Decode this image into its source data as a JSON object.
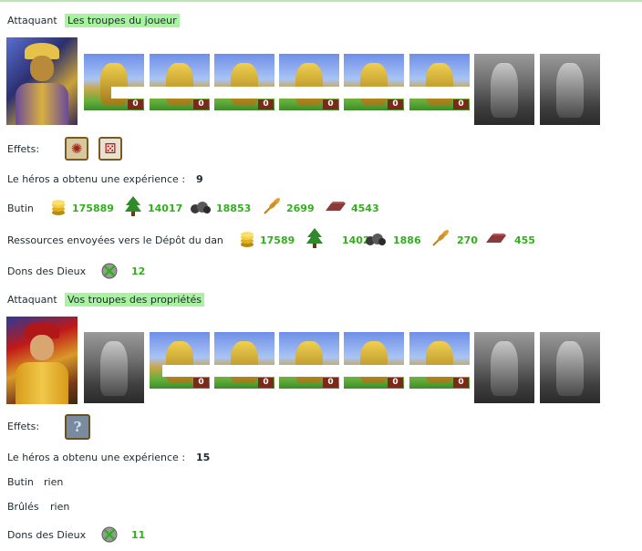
{
  "section1": {
    "attaquant_label": "Attaquant",
    "group_label": "Les troupes du joueur",
    "effets_label": "Effets:",
    "effect_icons": [
      "war-drums-effect-icon",
      "dice-effect-icon"
    ],
    "xp_label": "Le héros a obtenu une expérience :",
    "xp_value": "9",
    "butin_label": "Butin",
    "butin": [
      {
        "icon": "gold-coins-icon",
        "value": "175889"
      },
      {
        "icon": "wood-tree-icon",
        "value": "14017"
      },
      {
        "icon": "ore-stone-icon",
        "value": "18853"
      },
      {
        "icon": "wheat-icon",
        "value": "2699"
      },
      {
        "icon": "iron-ingot-icon",
        "value": "4543"
      }
    ],
    "sent_label": "Ressources envoyées vers le Dépôt du dan",
    "sent": [
      {
        "icon": "gold-coins-icon",
        "value": "17589"
      },
      {
        "icon": "wood-tree-icon",
        "value": "1402"
      },
      {
        "icon": "ore-stone-icon",
        "value": "1886"
      },
      {
        "icon": "wheat-icon",
        "value": "270"
      },
      {
        "icon": "iron-ingot-icon",
        "value": "455"
      }
    ],
    "dons_label": "Dons des Dieux",
    "dons_value": "12",
    "unit_counts": [
      "0",
      "0",
      "0",
      "0",
      "0",
      "0"
    ]
  },
  "section2": {
    "attaquant_label": "Attaquant",
    "group_label": "Vos troupes des propriétés",
    "effets_label": "Effets:",
    "effect_icons": [
      "unknown-question-effect-icon"
    ],
    "effect_glyph": "?",
    "xp_label": "Le héros a obtenu une expérience :",
    "xp_value": "15",
    "butin_label": "Butin",
    "butin_value": "rien",
    "brules_label": "Brûlés",
    "brules_value": "rien",
    "dons_label": "Dons des Dieux",
    "dons_value": "11",
    "unit_counts": [
      "0",
      "0",
      "0",
      "0",
      "0"
    ]
  },
  "colors": {
    "highlight": "#a8f2a0",
    "value_green": "#30b01c",
    "text": "#1e2a30"
  }
}
